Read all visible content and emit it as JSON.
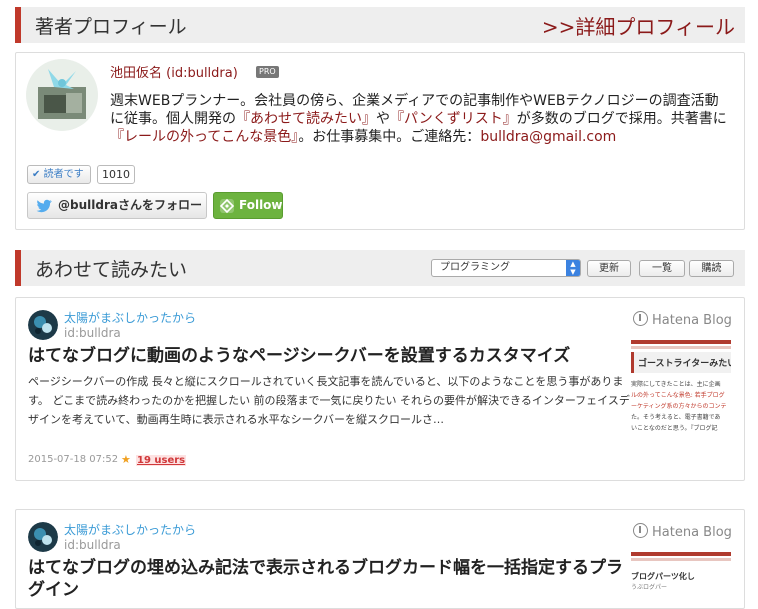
{
  "profile_section": {
    "title": "著者プロフィール",
    "detail_link": ">>詳細プロフィール"
  },
  "profile": {
    "name": "池田仮名 (id:bulldra)",
    "pro_badge": "PRO",
    "bio_part1": "週末WEBプランナー。会社員の傍ら、企業メディアでの記事制作やWEBテクノロジーの調査活動に従事。個人開発の",
    "bio_link1": "『あわせて読みたい』",
    "bio_part2": "や",
    "bio_link2": "『パンくずリスト』",
    "bio_part3": "が多数のブログで採用。共著書に",
    "bio_link3": "『レールの外ってこんな景色』",
    "bio_part4": "。お仕事募集中。ご連絡先：",
    "bio_email": "bulldra@gmail.com",
    "readers_label": "読者です",
    "readers_count": "1010",
    "twitter_follow": "@bulldraさんをフォロー",
    "feedly_follow": "Follow"
  },
  "related_section": {
    "title": "あわせて読みたい",
    "category_select": "プログラミング",
    "update_button": "更新",
    "list_button": "一覧",
    "subscribe_button": "購読"
  },
  "entries": [
    {
      "blog_name": "太陽がまぶしかったから",
      "blog_id": "id:bulldra",
      "title": "はてなブログに動画のようなページシークバーを設置するカスタマイズ",
      "summary": "ページシークバーの作成 長々と縦にスクロールされていく長文記事を読んでいると、以下のようなことを思う事があります。 どこまで読み終わったのかを把握したい 前の段落まで一気に戻りたい それらの要件が解決できるインターフェイスデザインを考えていて、動画再生時に表示される水平なシークバーを縦スクロールさ…",
      "date": "2015-07-18 07:52",
      "users": "19 users",
      "service_logo": "Hatena Blog",
      "thumb_heading": "ゴーストライターみたい",
      "thumb_lines": [
        "実際にしてきたことは、主に企画",
        "ルの外ってこんな景色: 若手プログ",
        "ーケティング系の方々からのコンテ",
        "た。そう考えると、電子書籍であ",
        "いことなのだと思う。『ブログ記"
      ]
    },
    {
      "blog_name": "太陽がまぶしかったから",
      "blog_id": "id:bulldra",
      "title": "はてなブログの埋め込み記法で表示されるブログカード幅を一括指定するプラグイン",
      "service_logo": "Hatena Blog",
      "thumb_heading": "ブログパーツ化し",
      "thumb_sub": "うぶログパー"
    }
  ],
  "colors": {
    "accent_red": "#c0392b",
    "link_dark_red": "#8b1a1a",
    "blog_name_blue": "#3b9bd6",
    "follow_green": "#6db33f"
  },
  "icons": [
    "check-icon",
    "twitter-bird-icon",
    "feedly-icon",
    "select-arrows-icon",
    "star-icon",
    "hatena-blog-logo-icon"
  ]
}
